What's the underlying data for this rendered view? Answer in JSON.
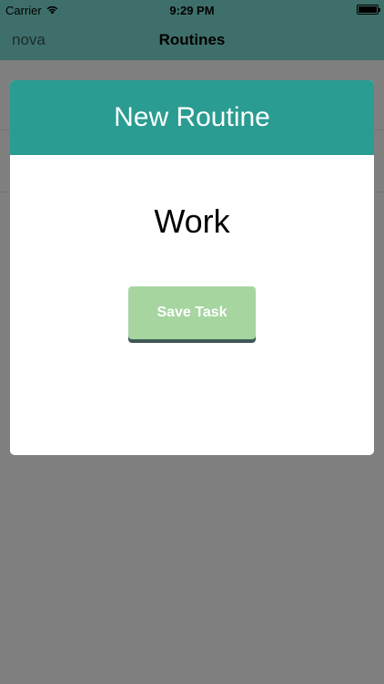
{
  "status_bar": {
    "carrier": "Carrier",
    "time": "9:29 PM",
    "wifi_icon": "wifi-icon",
    "battery_icon": "battery-icon"
  },
  "nav_bar": {
    "back_label": "nova",
    "title": "Routines"
  },
  "modal": {
    "header_title": "New Routine",
    "routine_name": "Work",
    "save_label": "Save Task"
  },
  "colors": {
    "header_teal": "#2a9c92",
    "save_button_green": "#a6d5a0",
    "navbar_dimmed": "#3f6f6a"
  }
}
